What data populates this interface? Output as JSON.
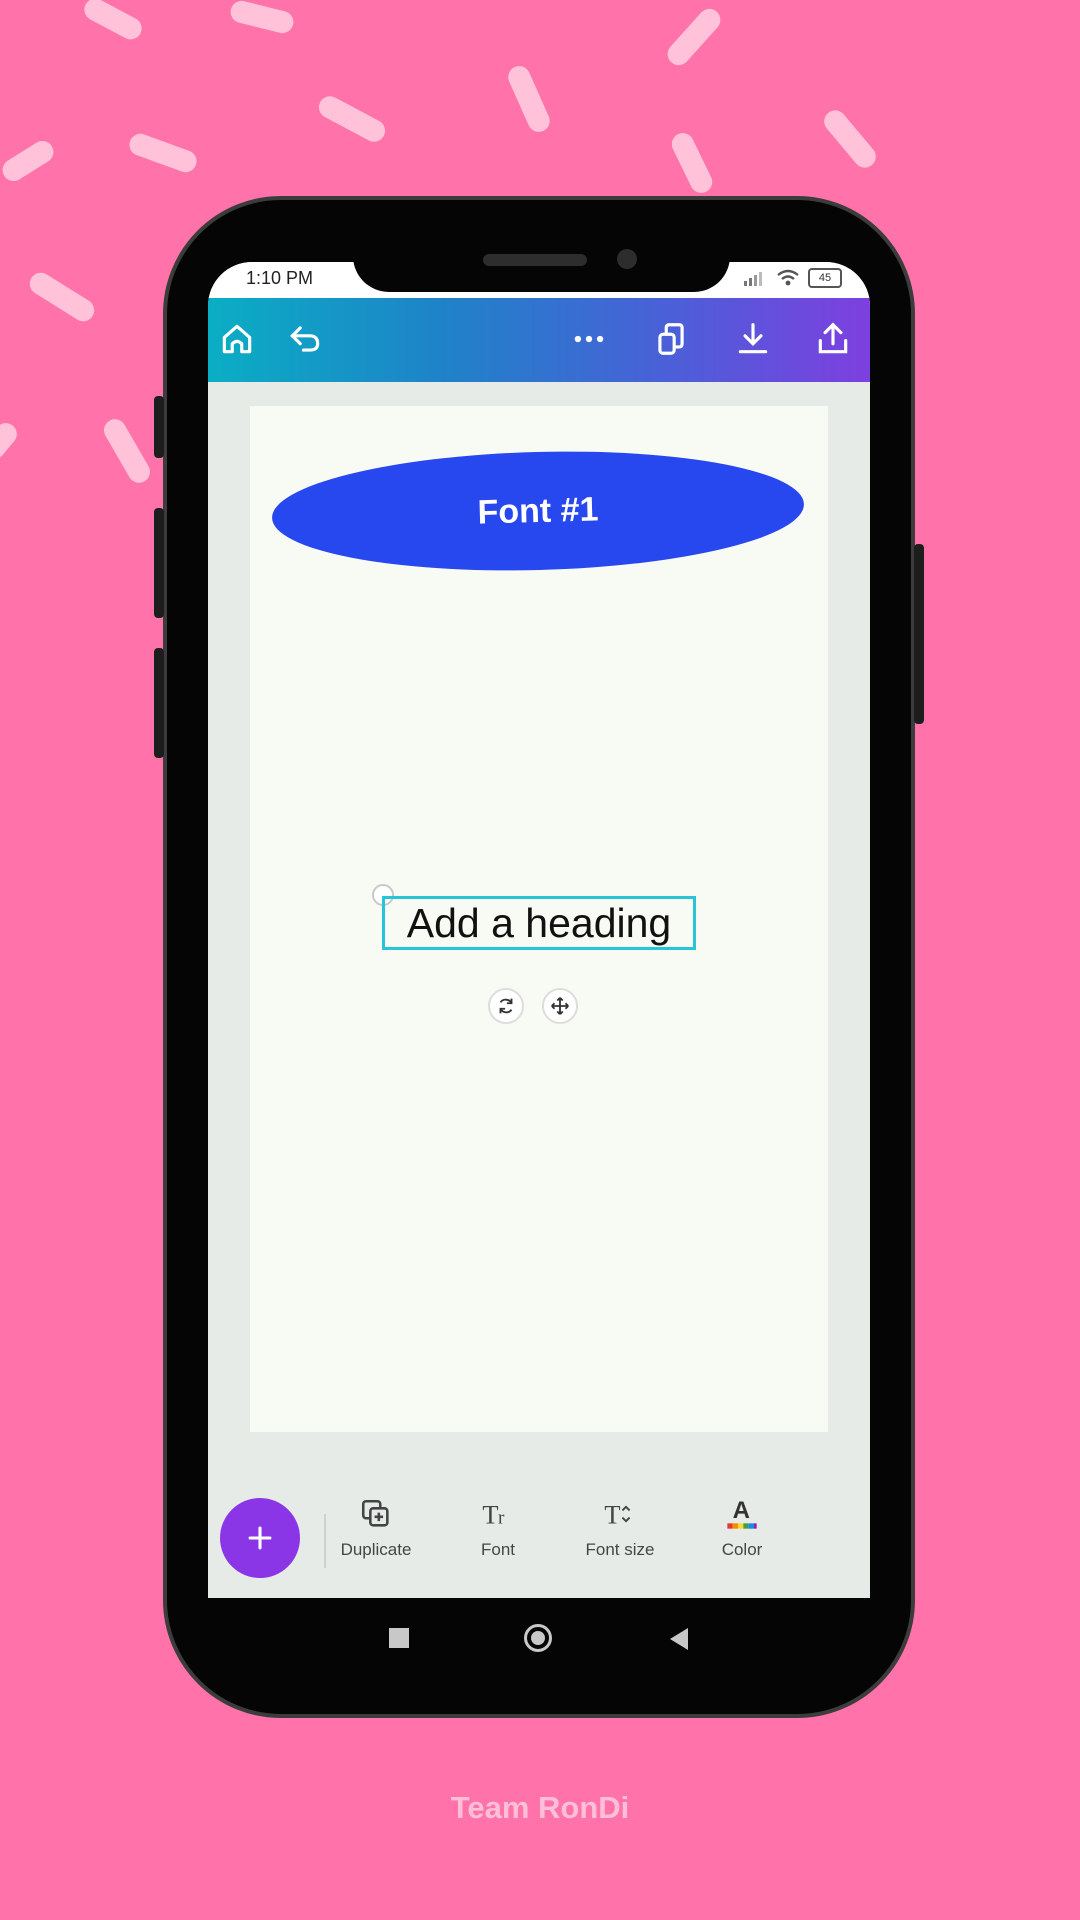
{
  "status_bar": {
    "time": "1:10 PM",
    "battery": "45"
  },
  "toolbar": {
    "icons": [
      "home-icon",
      "undo-icon",
      "more-icon",
      "pages-icon",
      "download-icon",
      "share-icon"
    ]
  },
  "canvas": {
    "badge_text": "Font #1",
    "heading_text": "Add a heading",
    "colors": {
      "badge": "#2747ef",
      "selection": "#28c5d6"
    }
  },
  "bottom_toolbar": {
    "add_icon": "plus-icon",
    "tools": [
      {
        "label": "Duplicate",
        "icon": "duplicate-icon"
      },
      {
        "label": "Font",
        "icon": "font-icon"
      },
      {
        "label": "Font size",
        "icon": "font-size-icon"
      },
      {
        "label": "Color",
        "icon": "color-icon"
      }
    ]
  },
  "footer": {
    "credit": "Team RonDi"
  },
  "colors": {
    "background": "#ff73aa",
    "accent_purple": "#8a35e6"
  }
}
